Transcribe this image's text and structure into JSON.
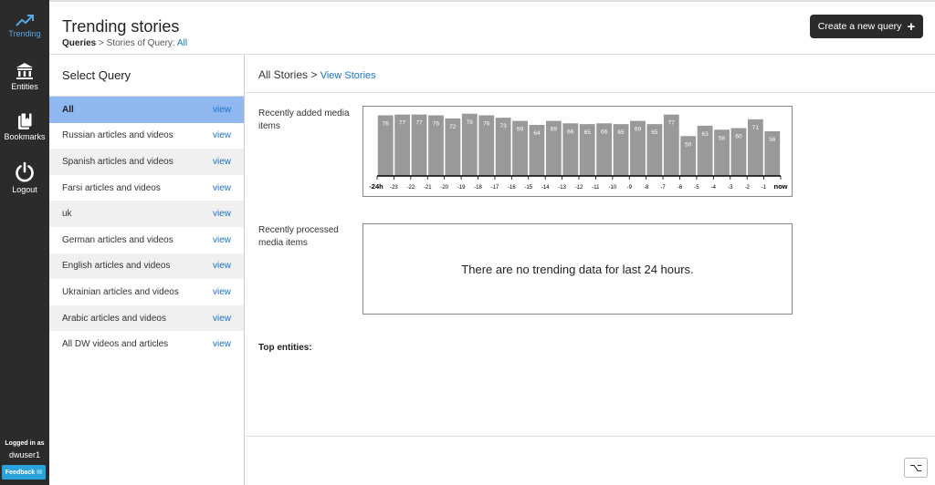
{
  "nav": {
    "items": [
      {
        "label": "Trending",
        "icon": "trending-icon"
      },
      {
        "label": "Entities",
        "icon": "bank-icon"
      },
      {
        "label": "Bookmarks",
        "icon": "bookmark-icon"
      },
      {
        "label": "Logout",
        "icon": "power-icon"
      }
    ],
    "logged_in_label": "Logged in as",
    "username": "dwuser1",
    "feedback_label": "Feedback"
  },
  "header": {
    "title": "Trending stories",
    "breadcrumb_root": "Queries",
    "breadcrumb_sep": " > ",
    "breadcrumb_prefix": "Stories of Query: ",
    "breadcrumb_current": "All",
    "create_button": "Create a new query"
  },
  "query_panel": {
    "title": "Select Query",
    "view_label": "view",
    "queries": [
      "All",
      "Russian articles and videos",
      "Spanish articles and videos",
      "Farsi articles and videos",
      "uk",
      "German articles and videos",
      "English articles and videos",
      "Ukrainian articles and videos",
      "Arabic articles and videos",
      "All DW videos and articles"
    ]
  },
  "main": {
    "heading": "All Stories",
    "heading_sep": " > ",
    "view_stories": "View Stories",
    "recent_added_label": "Recently added media items",
    "recent_processed_label": "Recently processed media items",
    "empty_message": "There are no trending data for last 24 hours.",
    "top_entities_label": "Top entities:",
    "corner_button": "⌥"
  },
  "chart_data": {
    "type": "bar",
    "categories": [
      "-24h",
      "-23",
      "-22",
      "-21",
      "-20",
      "-19",
      "-18",
      "-17",
      "-16",
      "-15",
      "-14",
      "-13",
      "-12",
      "-11",
      "-10",
      "-9",
      "-8",
      "-7",
      "-6",
      "-5",
      "-4",
      "-3",
      "-2",
      "-1",
      "now"
    ],
    "values": [
      76,
      77,
      77,
      76,
      72,
      78,
      76,
      73,
      69,
      64,
      69,
      66,
      65,
      66,
      65,
      69,
      65,
      77,
      50,
      63,
      58,
      60,
      71,
      56
    ],
    "ylim": [
      0,
      80
    ],
    "colors": {
      "bar": "#999999",
      "label": "#ffffff"
    }
  }
}
